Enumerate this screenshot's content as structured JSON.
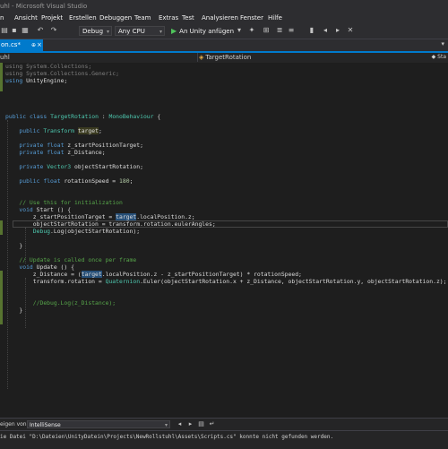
{
  "window": {
    "title": "uhl - Microsoft Visual Studio"
  },
  "menu": [
    {
      "id": "datei",
      "label": "n"
    },
    {
      "id": "ansicht",
      "label": "Ansicht"
    },
    {
      "id": "projekt",
      "label": "Projekt"
    },
    {
      "id": "erstellen",
      "label": "Erstellen"
    },
    {
      "id": "debuggen",
      "label": "Debuggen"
    },
    {
      "id": "team",
      "label": "Team"
    },
    {
      "id": "extras",
      "label": "Extras"
    },
    {
      "id": "test",
      "label": "Test"
    },
    {
      "id": "analysieren",
      "label": "Analysieren"
    },
    {
      "id": "fenster",
      "label": "Fenster"
    },
    {
      "id": "hilfe",
      "label": "Hilfe"
    }
  ],
  "toolbar": {
    "configuration": "Debug",
    "platform": "Any CPU",
    "run_label": "An Unity anfügen"
  },
  "tabs": {
    "active_label": "on.cs*",
    "pin_glyph": "⊕",
    "close_glyph": "×"
  },
  "navbar": {
    "left": "uhl",
    "member": "TargetRotation",
    "far": "Sta"
  },
  "code": {
    "lines": [
      [
        {
          "t": "using System.Collections;",
          "c": "dim"
        }
      ],
      [
        {
          "t": "using System.Collections.Generic;",
          "c": "dim"
        }
      ],
      [
        {
          "t": "using",
          "c": "kw"
        },
        {
          "t": " UnityEngine;"
        }
      ],
      [],
      [],
      [],
      [],
      [
        {
          "t": "public",
          "c": "kw"
        },
        {
          "t": " "
        },
        {
          "t": "class",
          "c": "kw"
        },
        {
          "t": " "
        },
        {
          "t": "TargetRotation",
          "c": "ty"
        },
        {
          "t": " : "
        },
        {
          "t": "MonoBehaviour",
          "c": "ty"
        },
        {
          "t": " {"
        }
      ],
      [],
      [
        {
          "t": "    "
        },
        {
          "t": "public",
          "c": "kw"
        },
        {
          "t": " "
        },
        {
          "t": "Transform",
          "c": "ty"
        },
        {
          "t": " "
        },
        {
          "t": "target",
          "c": "hl2"
        },
        {
          "t": ";"
        }
      ],
      [],
      [
        {
          "t": "    "
        },
        {
          "t": "private",
          "c": "kw"
        },
        {
          "t": " "
        },
        {
          "t": "float",
          "c": "kw"
        },
        {
          "t": " z_startPositionTarget;"
        }
      ],
      [
        {
          "t": "    "
        },
        {
          "t": "private",
          "c": "kw"
        },
        {
          "t": " "
        },
        {
          "t": "float",
          "c": "kw"
        },
        {
          "t": " z_Distance;"
        }
      ],
      [],
      [
        {
          "t": "    "
        },
        {
          "t": "private",
          "c": "kw"
        },
        {
          "t": " "
        },
        {
          "t": "Vector3",
          "c": "ty"
        },
        {
          "t": " objectStartRotation;"
        }
      ],
      [],
      [
        {
          "t": "    "
        },
        {
          "t": "public",
          "c": "kw"
        },
        {
          "t": " "
        },
        {
          "t": "float",
          "c": "kw"
        },
        {
          "t": " rotationSpeed = "
        },
        {
          "t": "180",
          "c": "num"
        },
        {
          "t": ";"
        }
      ],
      [],
      [],
      [
        {
          "t": "    "
        },
        {
          "t": "// Use this for initialization",
          "c": "cm"
        }
      ],
      [
        {
          "t": "    "
        },
        {
          "t": "void",
          "c": "kw"
        },
        {
          "t": " Start () {"
        }
      ],
      [
        {
          "t": "        z_startPositionTarget = "
        },
        {
          "t": "target",
          "c": "hl"
        },
        {
          "t": ".localPosition.z;"
        }
      ],
      [
        {
          "t": "        objectStartRotation = transform.rotation.eulerAngles;"
        }
      ],
      [
        {
          "t": "        "
        },
        {
          "t": "Debug",
          "c": "ty"
        },
        {
          "t": ".Log(objectStartRotation);"
        }
      ],
      [],
      [
        {
          "t": "    }"
        }
      ],
      [],
      [
        {
          "t": "    "
        },
        {
          "t": "// Update is called once per frame",
          "c": "cm"
        }
      ],
      [
        {
          "t": "    "
        },
        {
          "t": "void",
          "c": "kw"
        },
        {
          "t": " Update () {"
        }
      ],
      [
        {
          "t": "        z_Distance = ("
        },
        {
          "t": "target",
          "c": "hl"
        },
        {
          "t": ".localPosition.z - z_startPositionTarget) * rotationSpeed;"
        }
      ],
      [
        {
          "t": "        transform.rotation = "
        },
        {
          "t": "Quaternion",
          "c": "ty"
        },
        {
          "t": ".Euler(objectStartRotation.x + z_Distance, objectStartRotation.y, objectStartRotation.z);"
        }
      ],
      [],
      [],
      [
        {
          "t": "        "
        },
        {
          "t": "//Debug.Log(z_Distance);",
          "c": "cm"
        }
      ],
      [
        {
          "t": "    }"
        }
      ]
    ]
  },
  "output": {
    "show_label": "eigen von:",
    "source": "IntelliSense",
    "message": "ie Datei \"D:\\Dateien\\UnityDatein\\Projects\\NewRollstuhl\\Assets\\Scripts.cs\" konnte nicht gefunden werden."
  }
}
